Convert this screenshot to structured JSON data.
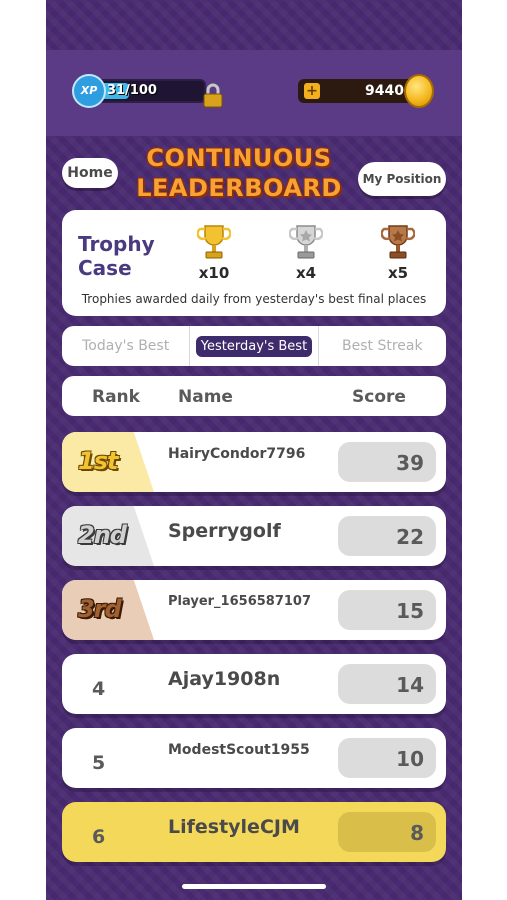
{
  "topbar": {
    "xp_badge": "XP",
    "xp_text": "31/100",
    "xp_progress": 0.31,
    "coins": "9440",
    "plus_label": "+"
  },
  "header": {
    "home_label": "Home",
    "title": "CONTINUOUS LEADERBOARD",
    "my_position_label": "My Position"
  },
  "trophy_case": {
    "label": "Trophy Case",
    "gold_count": "x10",
    "silver_count": "x4",
    "bronze_count": "x5",
    "note": "Trophies awarded daily from yesterday's best final places"
  },
  "tabs": [
    "Today's Best",
    "Yesterday's Best",
    "Best Streak"
  ],
  "active_tab": 1,
  "columns": {
    "rank": "Rank",
    "name": "Name",
    "score": "Score"
  },
  "rows": [
    {
      "rank": "1st",
      "name": "HairyCondor7796",
      "score": "39"
    },
    {
      "rank": "2nd",
      "name": "Sperrygolf",
      "score": "22"
    },
    {
      "rank": "3rd",
      "name": "Player_1656587107",
      "score": "15"
    },
    {
      "rank": "4",
      "name": "Ajay1908n",
      "score": "14"
    },
    {
      "rank": "5",
      "name": "ModestScout1955",
      "score": "10"
    },
    {
      "rank": "6",
      "name": "LifestyleCJM",
      "score": "8"
    }
  ],
  "colors": {
    "background": "#4a2a72",
    "gold": "#f2c230",
    "silver": "#9a9a9a",
    "bronze": "#9c5a2c",
    "highlight_row": "#f4d85a"
  }
}
